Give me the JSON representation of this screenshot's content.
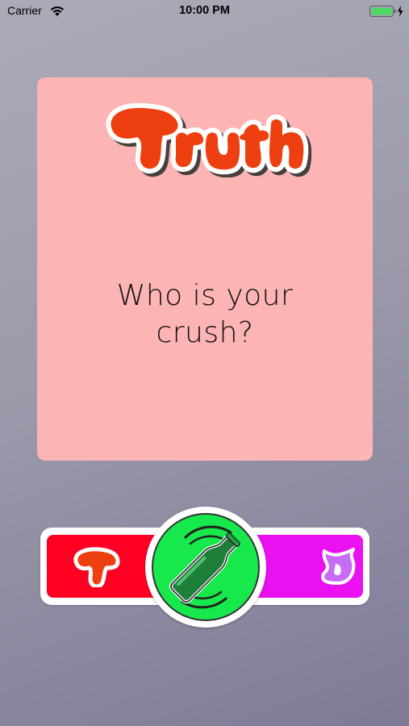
{
  "status_bar": {
    "carrier": "Carrier",
    "time": "10:00 PM",
    "wifi_icon": "wifi-icon",
    "battery_icon": "battery-charging-icon"
  },
  "card": {
    "logo_text": "Truth",
    "question": "Who is your crush?",
    "background_color": "#fdb4b4",
    "logo_color": "#ee3f10"
  },
  "controls": {
    "truth_button": {
      "icon": "letter-t-icon",
      "color": "#ff0022"
    },
    "spin_button": {
      "icon": "bottle-icon",
      "color": "#17e84b"
    },
    "dare_button": {
      "icon": "letter-d-icon",
      "color": "#ea10f0"
    }
  }
}
